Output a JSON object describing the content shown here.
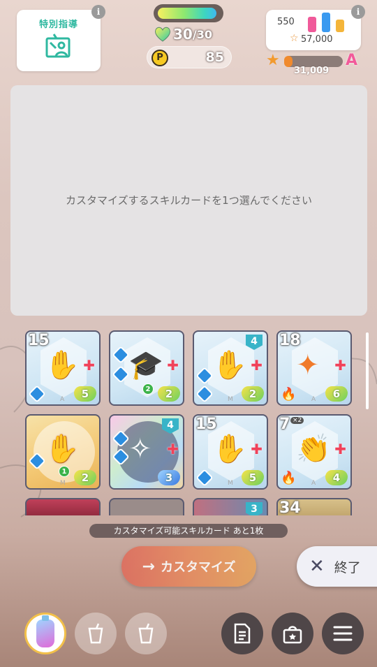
{
  "lesson": {
    "title": "特別指導",
    "info": "i"
  },
  "stamina": {
    "current": "30",
    "max": "/30",
    "fill_fraction": 0.95
  },
  "points": {
    "coin": "P",
    "value": "85"
  },
  "stats": {
    "value1": "550",
    "value2": "57,000",
    "info": "i"
  },
  "rank": {
    "score": "31,009",
    "letter": "A"
  },
  "panel": {
    "message": "カスタマイズするスキルカードを1つ選んでください"
  },
  "cards": [
    {
      "cost": "15",
      "heart": "5"
    },
    {
      "badge": "2",
      "heart": "2"
    },
    {
      "badge": "4",
      "heart": "2"
    },
    {
      "cost": "18",
      "heart": "6"
    },
    {
      "badge": "1",
      "heart": "2"
    },
    {
      "badge": "4",
      "heart": "3"
    },
    {
      "cost": "15",
      "heart": "5"
    },
    {
      "cost": "7",
      "mult": "×2",
      "heart": "4"
    }
  ],
  "peek": {
    "card3_badge": "3",
    "card4_cost": "34"
  },
  "remaining": "カスタマイズ可能スキルカード あと1枚",
  "buttons": {
    "customize": "カスタマイズ",
    "end": "終了"
  },
  "colors": {
    "accent": "#2fb8a0",
    "customize": "#e4805a",
    "dark": "#4f4648"
  }
}
